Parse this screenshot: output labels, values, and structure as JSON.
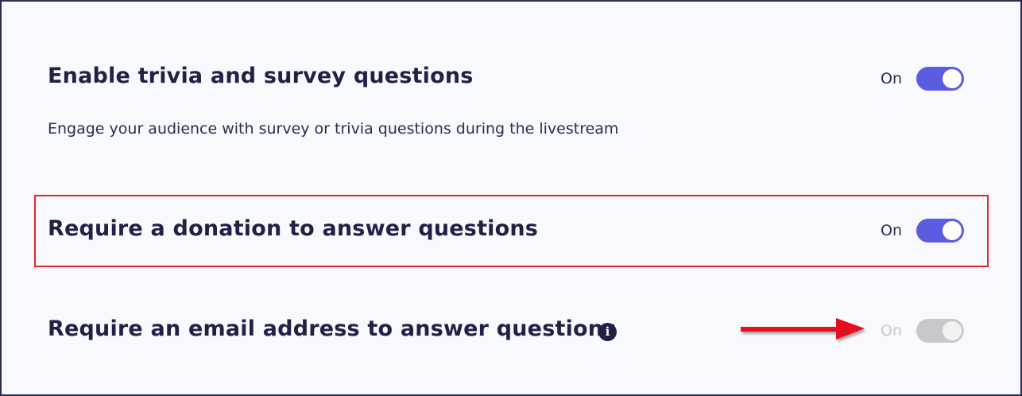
{
  "settings": [
    {
      "title": "Enable trivia and survey questions",
      "description": "Engage your audience with survey or trivia questions during the livestream",
      "toggle_label": "On",
      "state": "on"
    },
    {
      "title": "Require a donation to answer questions",
      "toggle_label": "On",
      "state": "on"
    },
    {
      "title": "Require an email address to answer questions",
      "toggle_label": "On",
      "state": "disabled",
      "info_icon": "i"
    }
  ],
  "annotations": {
    "highlight_color": "#e3262b",
    "arrow_color": "#e8111a"
  },
  "colors": {
    "toggle_on": "#5b5ce0",
    "toggle_disabled": "#c7c7cc",
    "text": "#1f2245"
  }
}
